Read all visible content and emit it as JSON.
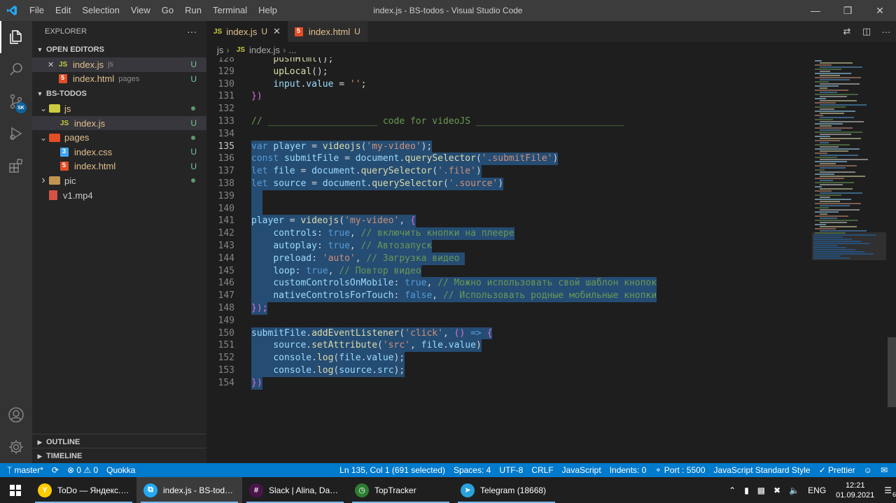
{
  "window": {
    "title": "index.js - BS-todos - Visual Studio Code",
    "menu": [
      "File",
      "Edit",
      "Selection",
      "View",
      "Go",
      "Run",
      "Terminal",
      "Help"
    ]
  },
  "activity": {
    "badge": "SK",
    "items": [
      "files-icon",
      "search-icon",
      "source-control-icon",
      "run-debug-icon",
      "extensions-icon"
    ],
    "bottom": [
      "account-icon",
      "gear-icon"
    ]
  },
  "sidebar": {
    "title": "EXPLORER",
    "more": "···",
    "open_editors_label": "OPEN EDITORS",
    "open_editors": [
      {
        "name": "index.js",
        "hint": "js",
        "status": "U",
        "kind": "js",
        "close": "✕"
      },
      {
        "name": "index.html",
        "hint": "pages",
        "status": "U",
        "kind": "html"
      }
    ],
    "project_label": "BS-TODOS",
    "tree": [
      {
        "name": "js",
        "kind": "folder",
        "indent": 1,
        "open": true,
        "status": "dot"
      },
      {
        "name": "index.js",
        "kind": "js",
        "indent": 2,
        "status": "U",
        "selected": true
      },
      {
        "name": "pages",
        "kind": "folder",
        "indent": 1,
        "open": true,
        "status": "dot"
      },
      {
        "name": "index.css",
        "kind": "css",
        "indent": 2,
        "status": "U"
      },
      {
        "name": "index.html",
        "kind": "html",
        "indent": 2,
        "status": "U"
      },
      {
        "name": "pic",
        "kind": "folder",
        "indent": 1,
        "open": false,
        "status": "dot"
      },
      {
        "name": "v1.mp4",
        "kind": "mp4",
        "indent": 1,
        "status": ""
      }
    ],
    "outline_label": "OUTLINE",
    "timeline_label": "TIMELINE"
  },
  "tabs": [
    {
      "icon": "JS",
      "label": "index.js",
      "status": "U",
      "active": true,
      "close": "✕"
    },
    {
      "icon": "5",
      "label": "index.html",
      "status": "U",
      "active": false
    }
  ],
  "breadcrumb": {
    "folder": "js",
    "icon": "JS",
    "file": "index.js",
    "tail": "..."
  },
  "editor": {
    "current_line": 135,
    "lines": [
      {
        "n": 128,
        "sel": false,
        "tokens": [
          [
            "    ",
            "p"
          ],
          [
            "pushHtml",
            "fn"
          ],
          [
            "();",
            "p"
          ]
        ]
      },
      {
        "n": 129,
        "sel": false,
        "tokens": [
          [
            "    ",
            "p"
          ],
          [
            "upLocal",
            "fn"
          ],
          [
            "();",
            "p"
          ]
        ]
      },
      {
        "n": 130,
        "sel": false,
        "tokens": [
          [
            "    ",
            "p"
          ],
          [
            "input",
            "var"
          ],
          [
            ".",
            "p"
          ],
          [
            "value",
            "var"
          ],
          [
            " = ",
            "p"
          ],
          [
            "''",
            "str"
          ],
          [
            ";",
            "p"
          ]
        ]
      },
      {
        "n": 131,
        "sel": false,
        "tokens": [
          [
            "})",
            "br"
          ]
        ]
      },
      {
        "n": 132,
        "sel": false,
        "tokens": []
      },
      {
        "n": 133,
        "sel": false,
        "tokens": [
          [
            "// ____________________ code for videoJS ___________________________",
            "cm"
          ]
        ]
      },
      {
        "n": 134,
        "sel": false,
        "tokens": []
      },
      {
        "n": 135,
        "sel": true,
        "tokens": [
          [
            "var",
            "kw"
          ],
          [
            " ",
            "p"
          ],
          [
            "player",
            "var"
          ],
          [
            " = ",
            "p"
          ],
          [
            "videojs",
            "fn"
          ],
          [
            "(",
            "p"
          ],
          [
            "'my-video'",
            "str"
          ],
          [
            ");",
            "p"
          ]
        ]
      },
      {
        "n": 136,
        "sel": true,
        "tokens": [
          [
            "const",
            "kw"
          ],
          [
            " ",
            "p"
          ],
          [
            "submitFile",
            "var"
          ],
          [
            " = ",
            "p"
          ],
          [
            "document",
            "var"
          ],
          [
            ".",
            "p"
          ],
          [
            "querySelector",
            "fn"
          ],
          [
            "(",
            "p"
          ],
          [
            "'.submitFile'",
            "str"
          ],
          [
            ")",
            "p"
          ]
        ]
      },
      {
        "n": 137,
        "sel": true,
        "tokens": [
          [
            "let",
            "kw"
          ],
          [
            " ",
            "p"
          ],
          [
            "file",
            "var"
          ],
          [
            " = ",
            "p"
          ],
          [
            "document",
            "var"
          ],
          [
            ".",
            "p"
          ],
          [
            "querySelector",
            "fn"
          ],
          [
            "(",
            "p"
          ],
          [
            "'.file'",
            "str"
          ],
          [
            ")",
            "p"
          ]
        ]
      },
      {
        "n": 138,
        "sel": true,
        "tokens": [
          [
            "let",
            "kw"
          ],
          [
            " ",
            "p"
          ],
          [
            "source",
            "var"
          ],
          [
            " = ",
            "p"
          ],
          [
            "document",
            "var"
          ],
          [
            ".",
            "p"
          ],
          [
            "querySelector",
            "fn"
          ],
          [
            "(",
            "p"
          ],
          [
            "'.source'",
            "str"
          ],
          [
            ")",
            "p"
          ]
        ]
      },
      {
        "n": 139,
        "sel": true,
        "tokens": [
          [
            "  ",
            "p"
          ]
        ]
      },
      {
        "n": 140,
        "sel": true,
        "tokens": [
          [
            "  ",
            "p"
          ]
        ]
      },
      {
        "n": 141,
        "sel": true,
        "tokens": [
          [
            "player",
            "var"
          ],
          [
            " = ",
            "p"
          ],
          [
            "videojs",
            "fn"
          ],
          [
            "(",
            "p"
          ],
          [
            "'my-video'",
            "str"
          ],
          [
            ", ",
            "p"
          ],
          [
            "{",
            "br"
          ]
        ]
      },
      {
        "n": 142,
        "sel": true,
        "tokens": [
          [
            "    ",
            "p"
          ],
          [
            "controls",
            "var"
          ],
          [
            ": ",
            "p"
          ],
          [
            "true",
            "kw"
          ],
          [
            ", ",
            "p"
          ],
          [
            "// включить кнопки на плеере",
            "cm"
          ]
        ]
      },
      {
        "n": 143,
        "sel": true,
        "tokens": [
          [
            "    ",
            "p"
          ],
          [
            "autoplay",
            "var"
          ],
          [
            ": ",
            "p"
          ],
          [
            "true",
            "kw"
          ],
          [
            ", ",
            "p"
          ],
          [
            "// Автозапуск",
            "cm"
          ]
        ]
      },
      {
        "n": 144,
        "sel": true,
        "tokens": [
          [
            "    ",
            "p"
          ],
          [
            "preload",
            "var"
          ],
          [
            ": ",
            "p"
          ],
          [
            "'auto'",
            "str"
          ],
          [
            ", ",
            "p"
          ],
          [
            "// Загрузка видео ",
            "cm"
          ]
        ]
      },
      {
        "n": 145,
        "sel": true,
        "tokens": [
          [
            "    ",
            "p"
          ],
          [
            "loop",
            "var"
          ],
          [
            ": ",
            "p"
          ],
          [
            "true",
            "kw"
          ],
          [
            ", ",
            "p"
          ],
          [
            "// Повтор видео",
            "cm"
          ]
        ]
      },
      {
        "n": 146,
        "sel": true,
        "tokens": [
          [
            "    ",
            "p"
          ],
          [
            "customControlsOnMobile",
            "var"
          ],
          [
            ": ",
            "p"
          ],
          [
            "true",
            "kw"
          ],
          [
            ", ",
            "p"
          ],
          [
            "// Можно использовать свой шаблон кнопок",
            "cm"
          ]
        ]
      },
      {
        "n": 147,
        "sel": true,
        "tokens": [
          [
            "    ",
            "p"
          ],
          [
            "nativeControlsForTouch",
            "var"
          ],
          [
            ": ",
            "p"
          ],
          [
            "false",
            "kw"
          ],
          [
            ", ",
            "p"
          ],
          [
            "// Использовать родные мобильные кнопки",
            "cm"
          ]
        ]
      },
      {
        "n": 148,
        "sel": true,
        "tokens": [
          [
            "});",
            "br"
          ]
        ]
      },
      {
        "n": 149,
        "sel": false,
        "tokens": []
      },
      {
        "n": 150,
        "sel": true,
        "tokens": [
          [
            "submitFile",
            "var"
          ],
          [
            ".",
            "p"
          ],
          [
            "addEventListener",
            "fn"
          ],
          [
            "(",
            "p"
          ],
          [
            "'click'",
            "str"
          ],
          [
            ", ",
            "p"
          ],
          [
            "()",
            "br"
          ],
          [
            " => ",
            "kw"
          ],
          [
            "{",
            "br"
          ]
        ]
      },
      {
        "n": 151,
        "sel": true,
        "tokens": [
          [
            "    ",
            "p"
          ],
          [
            "source",
            "var"
          ],
          [
            ".",
            "p"
          ],
          [
            "setAttribute",
            "fn"
          ],
          [
            "(",
            "p"
          ],
          [
            "'src'",
            "str"
          ],
          [
            ", ",
            "p"
          ],
          [
            "file",
            "var"
          ],
          [
            ".",
            "p"
          ],
          [
            "value",
            "var"
          ],
          [
            ")",
            "p"
          ]
        ]
      },
      {
        "n": 152,
        "sel": true,
        "tokens": [
          [
            "    ",
            "p"
          ],
          [
            "console",
            "var"
          ],
          [
            ".",
            "p"
          ],
          [
            "log",
            "fn"
          ],
          [
            "(",
            "p"
          ],
          [
            "file",
            "var"
          ],
          [
            ".",
            "p"
          ],
          [
            "value",
            "var"
          ],
          [
            ");",
            "p"
          ]
        ]
      },
      {
        "n": 153,
        "sel": true,
        "tokens": [
          [
            "    ",
            "p"
          ],
          [
            "console",
            "var"
          ],
          [
            ".",
            "p"
          ],
          [
            "log",
            "fn"
          ],
          [
            "(",
            "p"
          ],
          [
            "source",
            "var"
          ],
          [
            ".",
            "p"
          ],
          [
            "src",
            "var"
          ],
          [
            ");",
            "p"
          ]
        ]
      },
      {
        "n": 154,
        "sel": true,
        "tokens": [
          [
            "})",
            "br"
          ]
        ]
      }
    ]
  },
  "statusbar": {
    "branch": "master*",
    "sync_icon": "⟳",
    "problems": "⊗ 0 ⚠ 0",
    "quokka": "Quokka",
    "position": "Ln 135, Col 1 (691 selected)",
    "spaces": "Spaces: 4",
    "encoding": "UTF-8",
    "eol": "CRLF",
    "language": "JavaScript",
    "indents": "Indents: 0",
    "port": "Port : 5500",
    "standard": "JavaScript Standard Style",
    "prettier": "✓ Prettier"
  },
  "taskbar": {
    "items": [
      {
        "label": "ToDo — Яндекс.Бр...",
        "color": "#ffcc00",
        "glyph": "Y",
        "active": false
      },
      {
        "label": "index.js - BS-todos ...",
        "color": "#23a9f2",
        "glyph": "⧉",
        "active": true
      },
      {
        "label": "Slack | Alina, Daria ...",
        "color": "#4a154b",
        "glyph": "#",
        "active": false
      },
      {
        "label": "TopTracker",
        "color": "#2e7d32",
        "glyph": "◷",
        "active": false
      },
      {
        "label": "Telegram (18668)",
        "color": "#2aa1da",
        "glyph": "➤",
        "active": false
      }
    ],
    "lang": "ENG",
    "time": "12:21",
    "date": "01.09.2021",
    "notifications": "6"
  },
  "colors": {
    "accent": "#007acc",
    "selection": "#264f78",
    "untracked": "#73c991"
  }
}
